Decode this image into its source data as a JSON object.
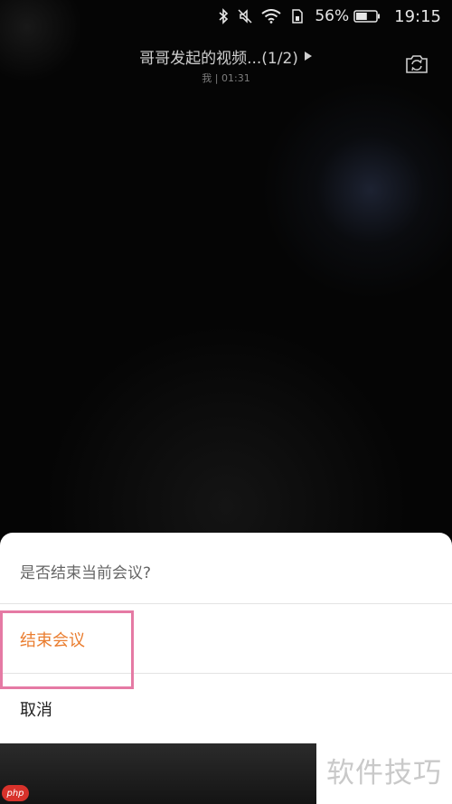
{
  "status_bar": {
    "battery_percent": "56%",
    "time": "19:15",
    "icons": [
      "bluetooth-icon",
      "mute-icon",
      "wifi-icon",
      "sim-icon",
      "battery-icon"
    ],
    "battery_level": 0.56
  },
  "call": {
    "title": "哥哥发起的视频...(1/2)",
    "subtitle": "我 | 01:31",
    "icons": [
      "play-arrow-icon",
      "switch-camera-icon"
    ]
  },
  "dialog": {
    "title": "是否结束当前会议?",
    "end_label": "结束会议",
    "cancel_label": "取消",
    "colors": {
      "end_text": "#ea7d2f",
      "highlight": "#e57aa4"
    }
  },
  "watermark": {
    "text": "软件技巧",
    "badge": "php"
  }
}
